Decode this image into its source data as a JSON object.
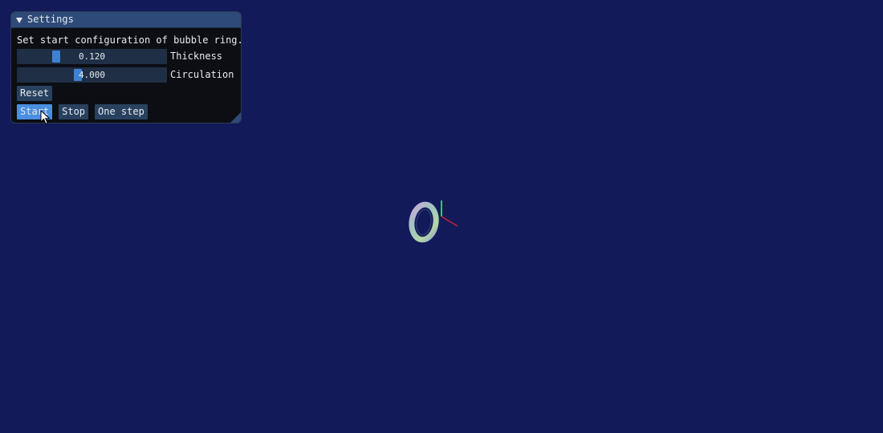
{
  "window": {
    "title": "Settings"
  },
  "settings": {
    "description": "Set start configuration of bubble ring.",
    "sliders": [
      {
        "label": "Thickness",
        "value_text": "0.120"
      },
      {
        "label": "Circulation",
        "value_text": "4.000"
      }
    ],
    "buttons": {
      "reset": "Reset",
      "start": "Start",
      "stop": "Stop",
      "one_step": "One step"
    }
  },
  "colors": {
    "background": "#121a5a",
    "title_bar": "#2e4a78",
    "accent": "#4a8ee0",
    "axis_x": "#cc2233",
    "axis_y": "#22dd33"
  },
  "icons": {
    "collapse": "collapse-arrow-icon",
    "cursor": "mouse-cursor-icon",
    "resize": "resize-grip-icon"
  }
}
